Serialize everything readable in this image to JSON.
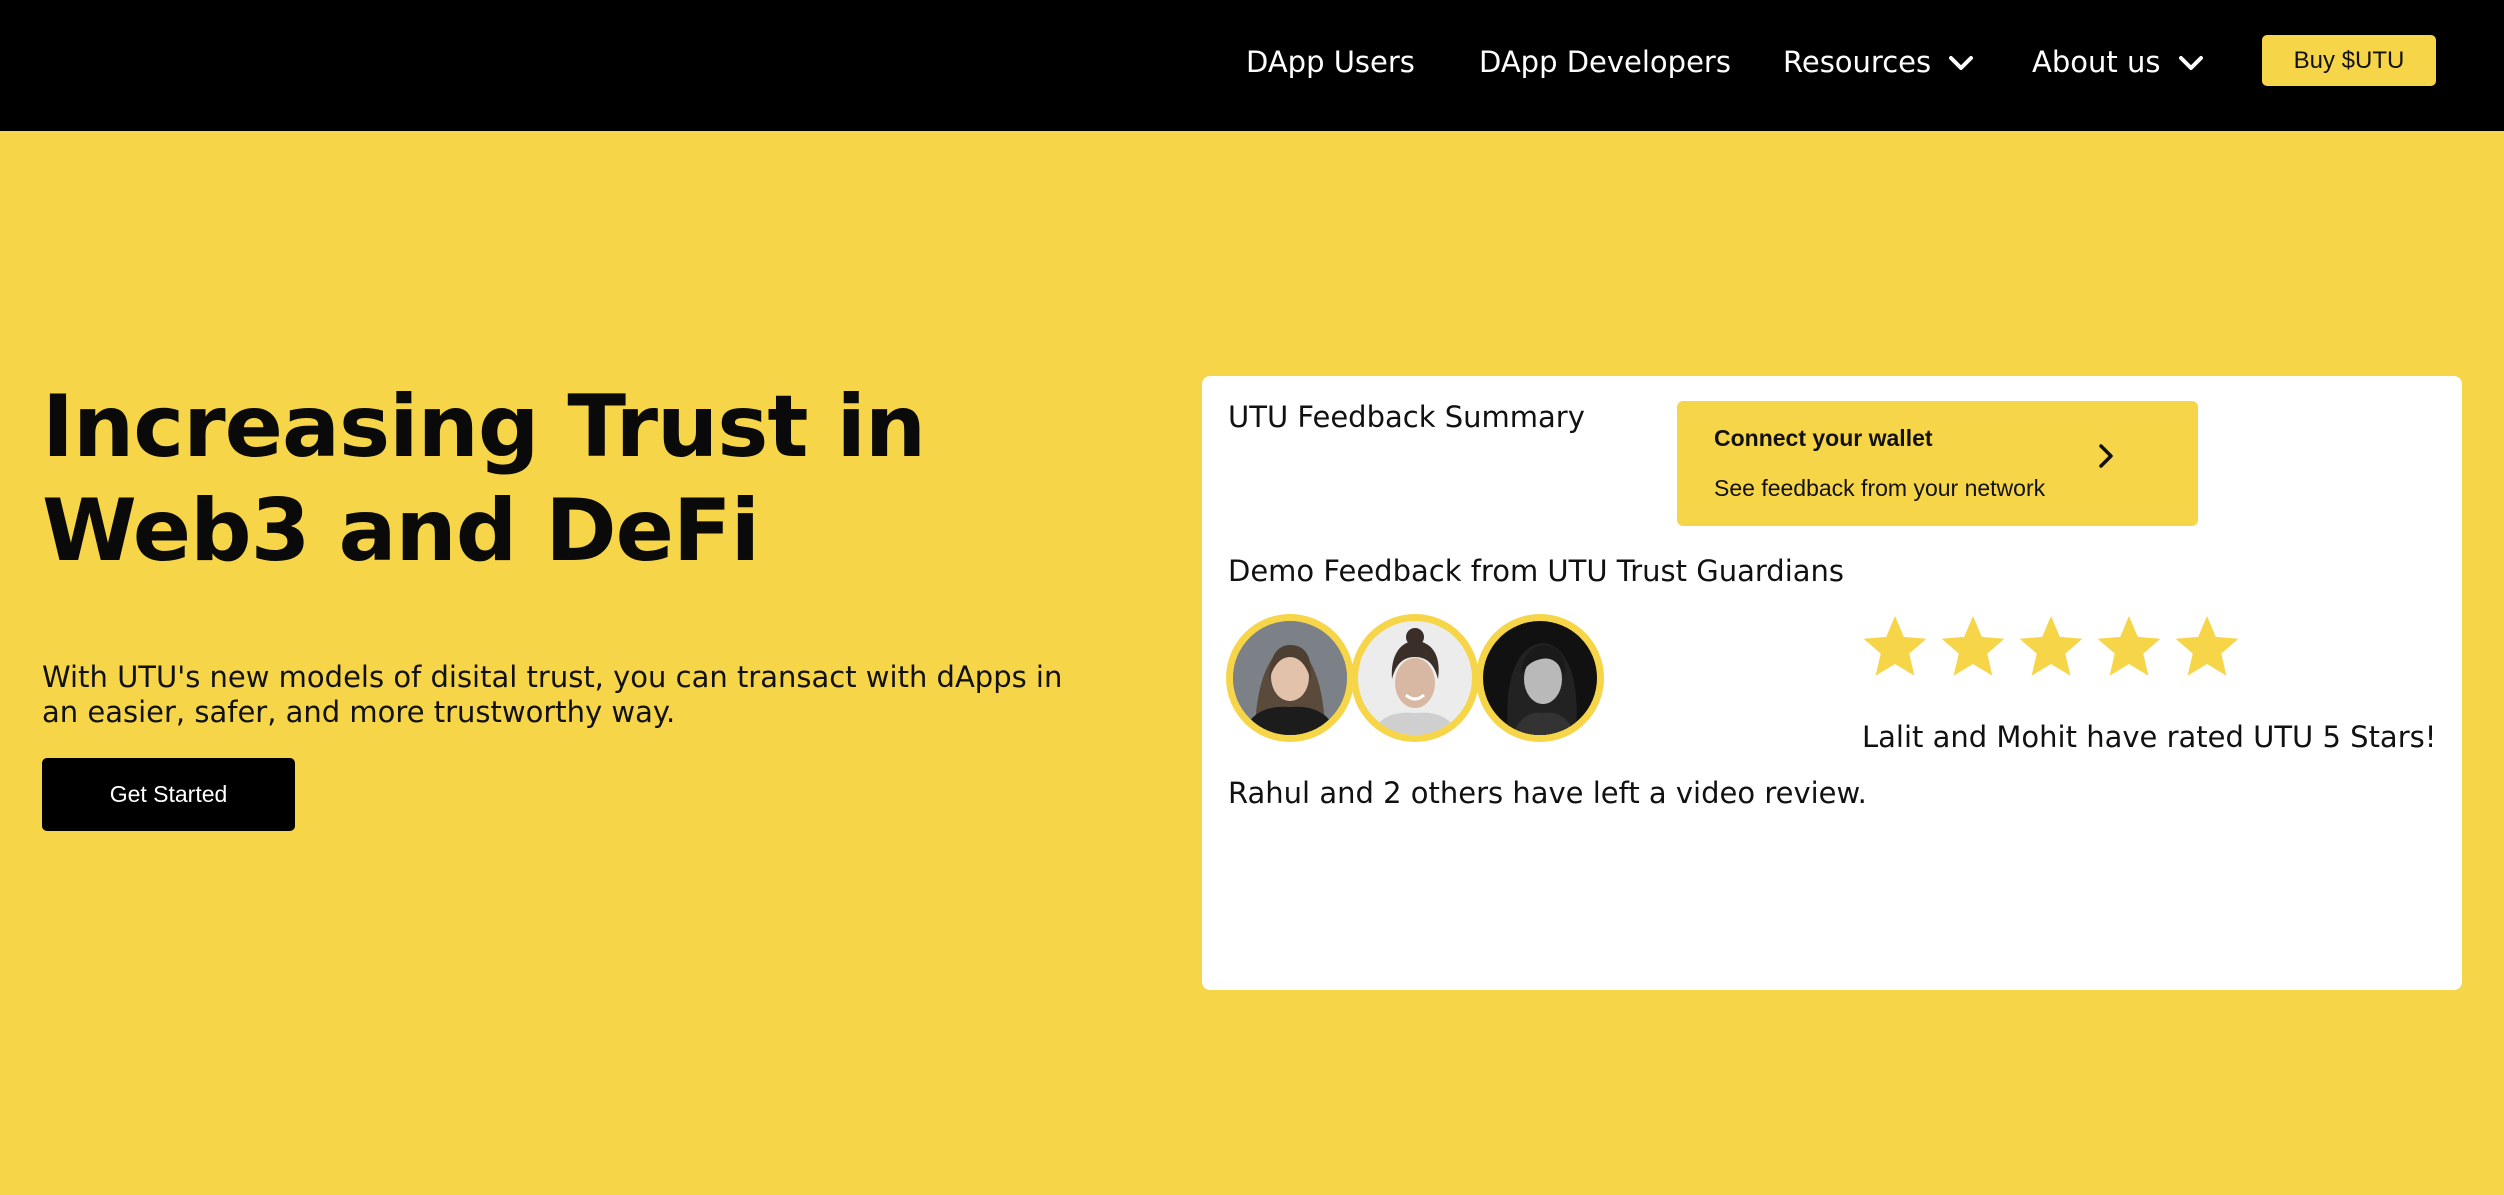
{
  "nav": {
    "items": [
      {
        "label": "DApp Users"
      },
      {
        "label": "DApp Developers"
      },
      {
        "label": "Resources",
        "has_dropdown": true
      },
      {
        "label": "About us",
        "has_dropdown": true
      }
    ],
    "buy_label": "Buy $UTU"
  },
  "hero": {
    "title_line1": "Increasing Trust in",
    "title_line2": "Web3 and DeFi",
    "subtitle": "With UTU's new models of disital trust, you can transact with dApps in an easier, safer, and more trustworthy way.",
    "cta_label": "Get Started"
  },
  "card": {
    "title": "UTU Feedback Summary",
    "wallet": {
      "title": "Connect your wallet",
      "subtitle": "See feedback from your network",
      "icon": "chevron-right-icon"
    },
    "demo_title": "Demo Feedback from UTU Trust Guardians",
    "avatars": [
      {
        "name": "guardian-avatar-1"
      },
      {
        "name": "guardian-avatar-2"
      },
      {
        "name": "guardian-avatar-3"
      }
    ],
    "review_text": "Rahul and 2 others have left a video review.",
    "rating": {
      "value": 5,
      "max": 5
    },
    "rated_text": "Lalit and Mohit have rated UTU 5 Stars!"
  },
  "colors": {
    "brand_yellow": "#F6D548",
    "nav_bg": "#000000",
    "star_yellow": "#F6D548",
    "text_dark": "#111111"
  }
}
